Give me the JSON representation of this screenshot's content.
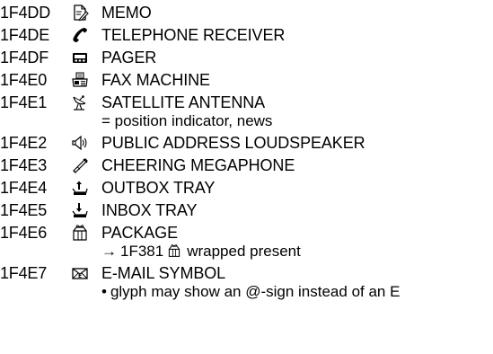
{
  "entries": [
    {
      "code": "1F4DD",
      "name": "MEMO",
      "icon": "memo-icon"
    },
    {
      "code": "1F4DE",
      "name": "TELEPHONE RECEIVER",
      "icon": "telephone-receiver-icon"
    },
    {
      "code": "1F4DF",
      "name": "PAGER",
      "icon": "pager-icon"
    },
    {
      "code": "1F4E0",
      "name": "FAX MACHINE",
      "icon": "fax-machine-icon"
    },
    {
      "code": "1F4E1",
      "name": "SATELLITE ANTENNA",
      "icon": "satellite-antenna-icon",
      "note": "= position indicator, news"
    },
    {
      "code": "1F4E2",
      "name": "PUBLIC ADDRESS LOUDSPEAKER",
      "icon": "loudspeaker-icon"
    },
    {
      "code": "1F4E3",
      "name": "CHEERING MEGAPHONE",
      "icon": "megaphone-icon"
    },
    {
      "code": "1F4E4",
      "name": "OUTBOX TRAY",
      "icon": "outbox-tray-icon"
    },
    {
      "code": "1F4E5",
      "name": "INBOX TRAY",
      "icon": "inbox-tray-icon"
    },
    {
      "code": "1F4E6",
      "name": "PACKAGE",
      "icon": "package-icon",
      "cross_ref": {
        "arrow": "→",
        "code": "1F381",
        "icon": "wrapped-present-icon",
        "text": "wrapped present"
      }
    },
    {
      "code": "1F4E7",
      "name": "E-MAIL SYMBOL",
      "icon": "email-symbol-icon",
      "bullet_note": {
        "bullet": "•",
        "text": "glyph may show an @-sign instead of an E"
      }
    }
  ]
}
